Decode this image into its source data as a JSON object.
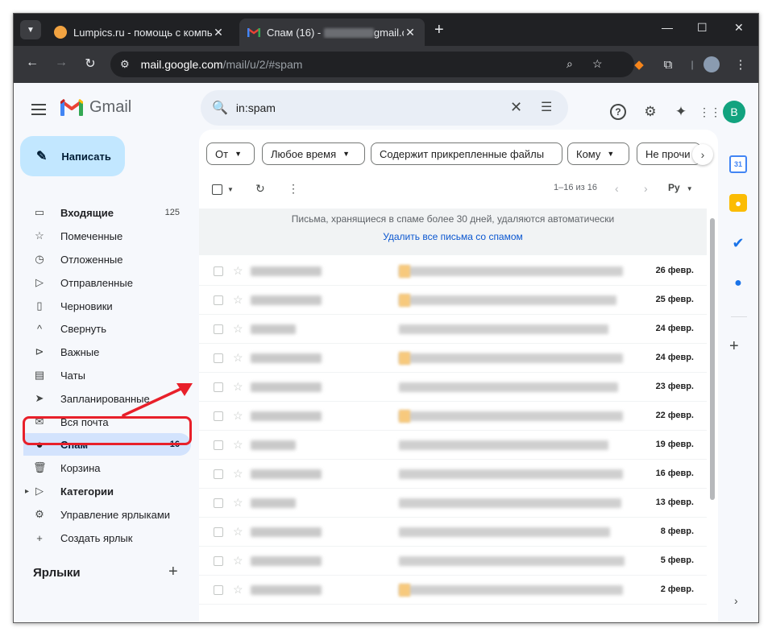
{
  "browser": {
    "tabs": [
      {
        "title": "Lumpics.ru - помощь с компь",
        "active": false
      },
      {
        "title_prefix": "Спам (16) - ",
        "title_suffix": "gmail.co",
        "active": true
      }
    ],
    "new_tab": "+",
    "window_controls": {
      "minimize": "—",
      "maximize": "☐",
      "close": "✕"
    },
    "nav": {
      "back": "←",
      "forward": "→",
      "reload": "↻"
    },
    "url": {
      "domain": "mail.google.com",
      "path": "/mail/u/2/#spam"
    }
  },
  "app": {
    "logo_text": "Gmail"
  },
  "compose": {
    "label": "Написать"
  },
  "sidebar": {
    "items": [
      {
        "label": "Входящие",
        "count": "125",
        "icon": "inbox-icon",
        "glyph": "▭"
      },
      {
        "label": "Помеченные",
        "count": "",
        "icon": "star-icon",
        "glyph": "☆"
      },
      {
        "label": "Отложенные",
        "count": "",
        "icon": "clock-icon",
        "glyph": "◷"
      },
      {
        "label": "Отправленные",
        "count": "",
        "icon": "send-icon",
        "glyph": "▷"
      },
      {
        "label": "Черновики",
        "count": "",
        "icon": "draft-icon",
        "glyph": "▯"
      },
      {
        "label": "Свернуть",
        "count": "",
        "icon": "collapse-icon",
        "glyph": "^"
      },
      {
        "label": "Важные",
        "count": "",
        "icon": "important-icon",
        "glyph": "⊳"
      },
      {
        "label": "Чаты",
        "count": "",
        "icon": "chat-icon",
        "glyph": "▤"
      },
      {
        "label": "Запланированные",
        "count": "",
        "icon": "scheduled-icon",
        "glyph": "➤"
      },
      {
        "label": "Вся почта",
        "count": "",
        "icon": "all-mail-icon",
        "glyph": "✉"
      },
      {
        "label": "Спам",
        "count": "16",
        "icon": "spam-icon",
        "glyph": "●"
      },
      {
        "label": "Корзина",
        "count": "",
        "icon": "trash-icon",
        "glyph": "🗑"
      },
      {
        "label": "Категории",
        "count": "",
        "icon": "category-icon",
        "glyph": "▷"
      },
      {
        "label": "Управление ярлыками",
        "count": "",
        "icon": "gear-icon",
        "glyph": "⚙"
      },
      {
        "label": "Создать ярлык",
        "count": "",
        "icon": "plus-icon",
        "glyph": "+"
      }
    ],
    "labels_header": "Ярлыки"
  },
  "search": {
    "query": "in:spam"
  },
  "filters": [
    {
      "label": "От",
      "dropdown": true
    },
    {
      "label": "Любое время",
      "dropdown": true
    },
    {
      "label": "Содержит прикрепленные файлы",
      "dropdown": false
    },
    {
      "label": "Кому",
      "dropdown": true
    },
    {
      "label": "Не прочи",
      "dropdown": false
    }
  ],
  "toolbar": {
    "page_info": "1–16 из 16",
    "lang": "Ру"
  },
  "notice": {
    "text": "Письма, хранящиеся в спаме более 30 дней, удаляются автоматически",
    "link": "Удалить все письма со спамом"
  },
  "emails": [
    {
      "date": "26 февр.",
      "tag": true
    },
    {
      "date": "25 февр.",
      "tag": true
    },
    {
      "date": "24 февр.",
      "tag": false
    },
    {
      "date": "24 февр.",
      "tag": true
    },
    {
      "date": "23 февр.",
      "tag": false
    },
    {
      "date": "22 февр.",
      "tag": true
    },
    {
      "date": "19 февр.",
      "tag": false
    },
    {
      "date": "16 февр.",
      "tag": false
    },
    {
      "date": "13 февр.",
      "tag": false
    },
    {
      "date": "8 февр.",
      "tag": false
    },
    {
      "date": "5 февр.",
      "tag": false
    },
    {
      "date": "2 февр.",
      "tag": true
    }
  ],
  "account": {
    "initial": "B",
    "color": "#12a37f"
  },
  "colors": {
    "accent": "#d3e3fd",
    "compose": "#c2e7ff",
    "highlight": "#e8202a",
    "link": "#0b57d0"
  }
}
